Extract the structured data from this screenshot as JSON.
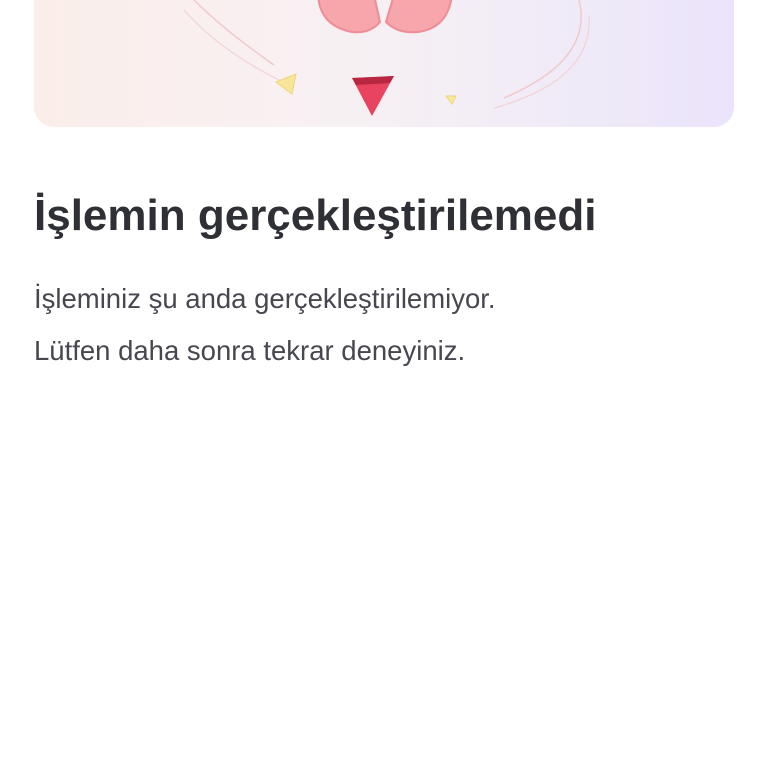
{
  "illustration": {
    "icon": "broken-heart-icon",
    "colors": {
      "heart": "#f7a5aa",
      "heart_outline": "#ef8a92",
      "red_triangle": "#e8435f",
      "yellow_triangle": "#f6e79a",
      "curve": "#f0c4c6"
    }
  },
  "error": {
    "title": "İşlemin gerçekleştirilemedi",
    "message_line1": "İşleminiz şu anda gerçekleştirilemiyor.",
    "message_line2": "Lütfen daha sonra tekrar deneyiniz."
  }
}
